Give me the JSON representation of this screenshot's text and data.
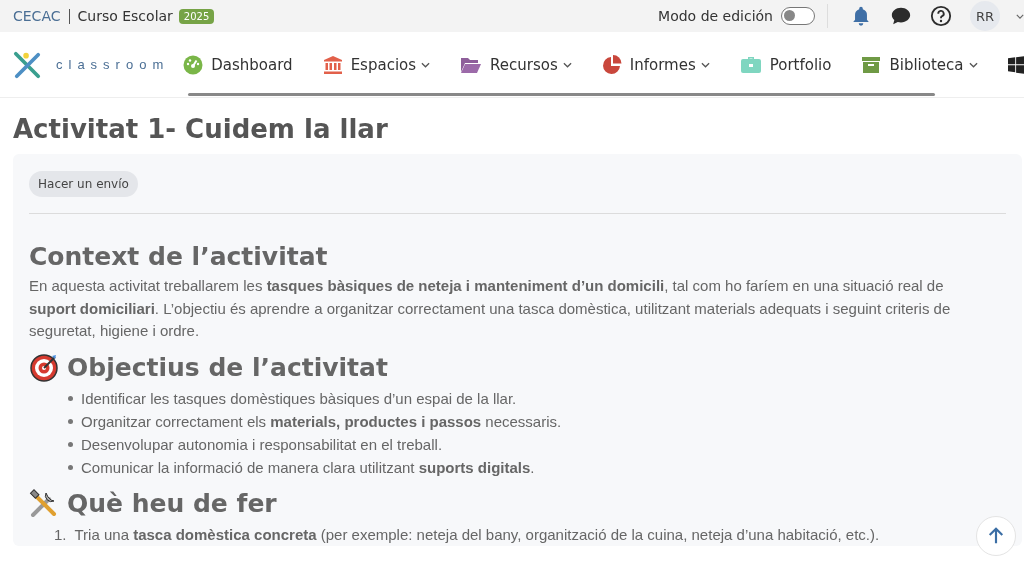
{
  "topbar": {
    "org": "CECAC",
    "course": "Curso Escolar",
    "year_badge": "2025",
    "edit_mode": {
      "label": "Modo de edición",
      "on": false
    },
    "avatar": "RR"
  },
  "nav": {
    "logo_text": "classroom",
    "items": [
      {
        "label": "Dashboard",
        "dropdown": false
      },
      {
        "label": "Espacios",
        "dropdown": true
      },
      {
        "label": "Recursos",
        "dropdown": true
      },
      {
        "label": "Informes",
        "dropdown": true
      },
      {
        "label": "Portfolio",
        "dropdown": false
      },
      {
        "label": "Biblioteca",
        "dropdown": true
      }
    ]
  },
  "page_title": "Activitat 1- Cuidem la llar",
  "submit_button": "Hacer un envío",
  "sections": [
    {
      "heading": "Context de l’activitat",
      "kind": "paragraph",
      "text": "En aquesta activitat treballarem les **tasques bàsiques de neteja i manteniment d’un domicili**, tal com ho faríem en una situació real de **suport domiciliari**. L’objectiu és aprendre a organitzar correctament una tasca domèstica, utilitzant materials adequats i seguint criteris de seguretat, higiene i ordre."
    },
    {
      "heading": "Objectius de l’activitat",
      "kind": "bullets",
      "items": [
        "Identificar les tasques domèstiques bàsiques d’un espai de la llar.",
        "Organitzar correctament els **materials, productes i passos** necessaris.",
        "Desenvolupar autonomia i responsabilitat en el treball.",
        "Comunicar la informació de manera clara utilitzant **suports digitals**."
      ]
    },
    {
      "heading": "Què heu de fer",
      "kind": "numbered",
      "items": [
        {
          "number": "1.",
          "text": "Tria una **tasca domèstica concreta** (per exemple: neteja del bany, organització de la cuina, neteja d’una habitació, etc.)."
        }
      ]
    }
  ]
}
